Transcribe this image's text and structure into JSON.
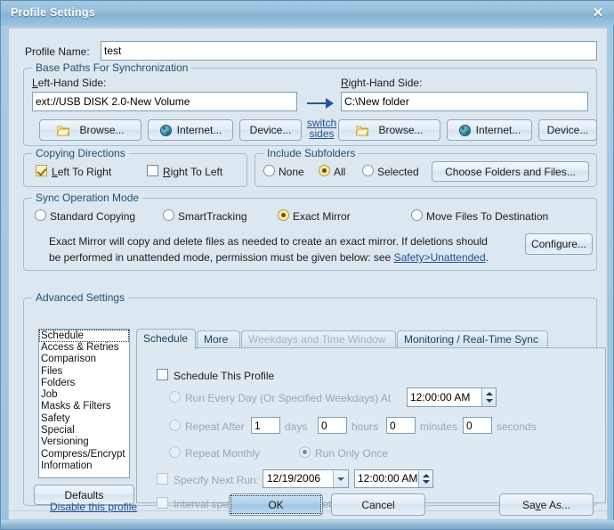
{
  "window": {
    "title": "Profile Settings",
    "close_icon": "close-icon",
    "accent": "#92bcda",
    "client_bg": "#dce7ef"
  },
  "profile": {
    "name_label": "Profile Name:",
    "name_value": "test"
  },
  "base_paths": {
    "group_label": "Base Paths For Synchronization",
    "left_label": "Left-Hand Side:",
    "left_value": "ext://USB DISK 2.0-New Volume",
    "right_label": "Right-Hand Side:",
    "right_value": "C:\\New folder",
    "switch_link_line1": "switch",
    "switch_link_line2": "sides",
    "arrow_icon": "arrow-right-icon",
    "left_buttons": [
      {
        "label": "Browse...",
        "icon": "folder-icon"
      },
      {
        "label": "Internet...",
        "icon": "globe-icon"
      },
      {
        "label": "Device...",
        "icon": "none"
      }
    ],
    "right_buttons": [
      {
        "label": "Browse...",
        "icon": "folder-icon"
      },
      {
        "label": "Internet...",
        "icon": "globe-icon"
      },
      {
        "label": "Device...",
        "icon": "none"
      }
    ]
  },
  "copying_directions": {
    "group_label": "Copying Directions",
    "left_to_right": {
      "label": "Left To Right",
      "checked": true
    },
    "right_to_left": {
      "label": "Right To Left",
      "checked": false
    }
  },
  "include_subfolders": {
    "group_label": "Include Subfolders",
    "options": [
      {
        "label": "None",
        "selected": false
      },
      {
        "label": "All",
        "selected": true
      },
      {
        "label": "Selected",
        "selected": false
      }
    ],
    "choose_button": "Choose Folders and Files..."
  },
  "sync_mode": {
    "group_label": "Sync Operation Mode",
    "options": [
      {
        "label": "Standard Copying",
        "selected": false
      },
      {
        "label": "SmartTracking",
        "selected": false
      },
      {
        "label": "Exact Mirror",
        "selected": true
      },
      {
        "label": "Move Files To Destination",
        "selected": false
      }
    ],
    "description_line1": "Exact Mirror will copy and delete files as needed to create an exact mirror. If deletions should",
    "description_line2_pre": "be performed in unattended mode, permission must be given below: see ",
    "description_link": "Safety>Unattended",
    "description_line2_post": ".",
    "configure_button": "Configure..."
  },
  "advanced_settings": {
    "group_label": "Advanced Settings",
    "items": [
      "Schedule",
      "Access & Retries",
      "Comparison",
      "Files",
      "Folders",
      "Job",
      "Masks & Filters",
      "Safety",
      "Special",
      "Versioning",
      "Compress/Encrypt",
      "Information"
    ],
    "selected_index": 0,
    "defaults_button": "Defaults"
  },
  "tabs": [
    {
      "label": "Schedule",
      "active": true,
      "disabled": false
    },
    {
      "label": "More",
      "active": false,
      "disabled": false
    },
    {
      "label": "Weekdays and Time Window",
      "active": false,
      "disabled": true
    },
    {
      "label": "Monitoring / Real-Time Sync",
      "active": false,
      "disabled": false
    }
  ],
  "schedule_panel": {
    "schedule_this_profile": {
      "label": "Schedule This Profile",
      "checked": false
    },
    "run_every_day": {
      "label": "Run Every Day (Or Specified Weekdays) At",
      "selected": false,
      "disabled": true
    },
    "run_every_day_time": "12:00:00 AM",
    "repeat_after": {
      "label": "Repeat After",
      "selected": false,
      "disabled": true
    },
    "repeat_fields": [
      {
        "value": "1",
        "unit": "days"
      },
      {
        "value": "0",
        "unit": "hours"
      },
      {
        "value": "0",
        "unit": "minutes"
      },
      {
        "value": "0",
        "unit": "seconds"
      }
    ],
    "repeat_monthly": {
      "label": "Repeat Monthly",
      "selected": false,
      "disabled": true
    },
    "run_only_once": {
      "label": "Run Only Once",
      "selected": true,
      "disabled": true
    },
    "specify_next_run": {
      "label": "Specify Next Run:",
      "checked": false,
      "disabled": true
    },
    "next_run_date": "12/19/2006",
    "next_run_time": "12:00:00 AM",
    "interval_idle": {
      "label": "Interval specifies the idle time between runs",
      "checked": false,
      "disabled": true
    }
  },
  "footer": {
    "disable_link": "Disable this profile",
    "ok_button": "OK",
    "cancel_button": "Cancel",
    "save_as_button": "Save As..."
  }
}
